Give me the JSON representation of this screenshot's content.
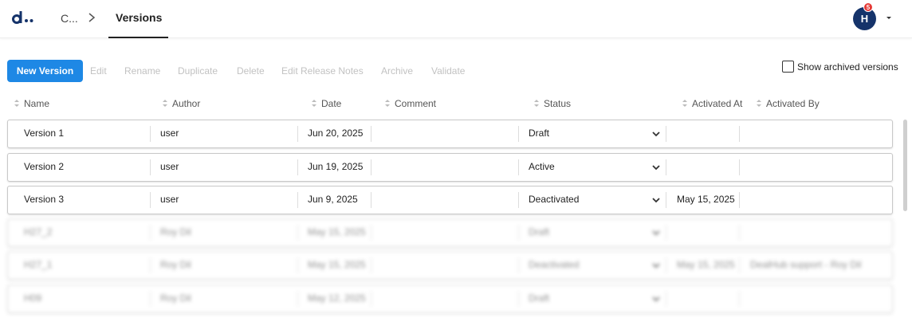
{
  "header": {
    "breadcrumb": "C...",
    "active_tab": "Versions",
    "avatar_initial": "H",
    "notification_count": "5"
  },
  "toolbar": {
    "new_version": "New Version",
    "edit": "Edit",
    "rename": "Rename",
    "duplicate": "Duplicate",
    "delete": "Delete",
    "edit_release_notes": "Edit Release Notes",
    "archive": "Archive",
    "validate": "Validate",
    "show_archived": "Show archived versions"
  },
  "columns": {
    "name": "Name",
    "author": "Author",
    "date": "Date",
    "comment": "Comment",
    "status": "Status",
    "activated_at": "Activated At",
    "activated_by": "Activated By"
  },
  "rows": [
    {
      "name": "Version 1",
      "author": "user",
      "date": "Jun 20, 2025",
      "comment": "",
      "status": "Draft",
      "activated_at": "",
      "activated_by": ""
    },
    {
      "name": "Version 2",
      "author": "user",
      "date": "Jun 19, 2025",
      "comment": "",
      "status": "Active",
      "activated_at": "",
      "activated_by": ""
    },
    {
      "name": "Version 3",
      "author": "user",
      "date": "Jun 9, 2025",
      "comment": "",
      "status": "Deactivated",
      "activated_at": "May 15, 2025",
      "activated_by": ""
    },
    {
      "name": "H27_2",
      "author": "Roy Dil",
      "date": "May 15, 2025",
      "comment": "",
      "status": "Draft",
      "activated_at": "",
      "activated_by": ""
    },
    {
      "name": "H27_1",
      "author": "Roy Dil",
      "date": "May 15, 2025",
      "comment": "",
      "status": "Deactivated",
      "activated_at": "May 15, 2025",
      "activated_by": "DealHub support - Roy Dil"
    },
    {
      "name": "H09",
      "author": "Roy Dil",
      "date": "May 12, 2025",
      "comment": "",
      "status": "Draft",
      "activated_at": "",
      "activated_by": ""
    }
  ],
  "colors": {
    "primary": "#1e88e5",
    "brand": "#15336a",
    "badge": "#e53935"
  }
}
